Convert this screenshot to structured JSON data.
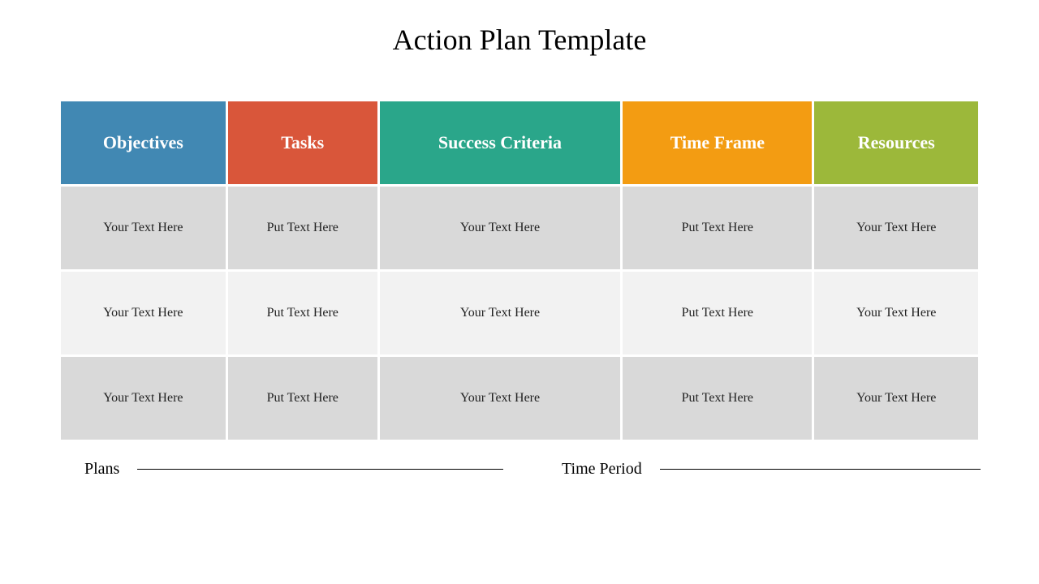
{
  "title": "Action Plan Template",
  "columns": [
    {
      "label": "Objectives",
      "color": "#4188b3"
    },
    {
      "label": "Tasks",
      "color": "#d9563a"
    },
    {
      "label": "Success Criteria",
      "color": "#2aa68a"
    },
    {
      "label": "Time Frame",
      "color": "#f39c12"
    },
    {
      "label": "Resources",
      "color": "#9cb83a"
    }
  ],
  "rows": [
    {
      "cells": [
        "Your Text Here",
        "Put Text Here",
        "Your Text Here",
        "Put Text Here",
        "Your Text Here"
      ]
    },
    {
      "cells": [
        "Your Text Here",
        "Put Text Here",
        "Your Text Here",
        "Put Text Here",
        "Your Text Here"
      ]
    },
    {
      "cells": [
        "Your Text Here",
        "Put Text Here",
        "Your Text Here",
        "Put Text Here",
        "Your Text Here"
      ]
    }
  ],
  "footer": {
    "left": "Plans",
    "right": "Time Period"
  }
}
